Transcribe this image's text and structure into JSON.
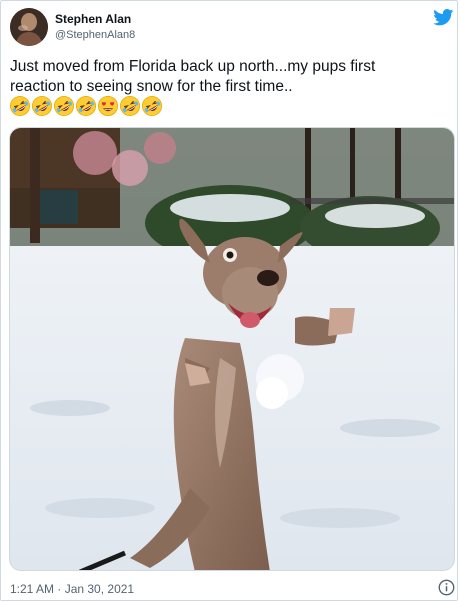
{
  "tweet": {
    "author_name": "Stephen Alan",
    "author_handle": "@StephenAlan8",
    "text_line1": "Just moved from Florida back up north...my pups first",
    "text_line2": "reaction to seeing snow for the first time..",
    "emojis": [
      "rolling-on-floor-laughing",
      "rolling-on-floor-laughing",
      "rolling-on-floor-laughing",
      "rolling-on-floor-laughing",
      "heart-eyes",
      "rolling-on-floor-laughing",
      "rolling-on-floor-laughing"
    ],
    "timestamp": "1:21 AM · Jan 30, 2021"
  },
  "icons": {
    "platform": "twitter-bird-icon",
    "info": "info-icon"
  },
  "colors": {
    "brand": "#1d9bf0",
    "text_primary": "#0f1419",
    "text_secondary": "#536471",
    "border": "#cfd9de"
  }
}
